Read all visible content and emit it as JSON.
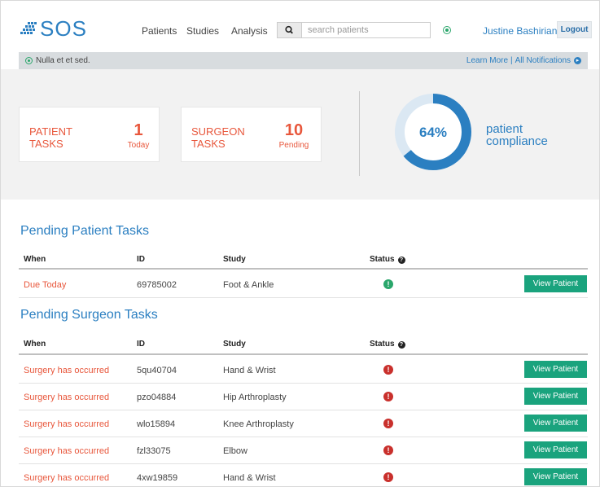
{
  "header": {
    "logo_text": "SOS",
    "nav": [
      "Patients",
      "Studies",
      "Analysis"
    ],
    "search": {
      "placeholder": "search patients",
      "value": ""
    },
    "user_name": "Justine Bashirian",
    "logout_label": "Logout"
  },
  "notice": {
    "message": "Nulla et et sed.",
    "learn_more": "Learn More",
    "separator": "|",
    "all_notifications": "All Notifications"
  },
  "stats": {
    "patient_tasks": {
      "label_line1": "PATIENT",
      "label_line2": "TASKS",
      "count": "1",
      "sub": "Today"
    },
    "surgeon_tasks": {
      "label_line1": "SURGEON",
      "label_line2": "TASKS",
      "count": "10",
      "sub": "Pending"
    },
    "compliance": {
      "percent_text": "64%",
      "value": 0.64,
      "label_line1": "patient",
      "label_line2": "compliance"
    }
  },
  "columns": {
    "when": "When",
    "id": "ID",
    "study": "Study",
    "status": "Status"
  },
  "pending_patient": {
    "title": "Pending Patient Tasks",
    "rows": [
      {
        "when": "Due Today",
        "id": "69785002",
        "study": "Foot & Ankle",
        "status": "ok",
        "button": "View Patient"
      }
    ]
  },
  "pending_surgeon": {
    "title": "Pending Surgeon Tasks",
    "rows": [
      {
        "when": "Surgery has occurred",
        "id": "5qu40704",
        "study": "Hand & Wrist",
        "status": "alert",
        "button": "View Patient"
      },
      {
        "when": "Surgery has occurred",
        "id": "pzo04884",
        "study": "Hip Arthroplasty",
        "status": "alert",
        "button": "View Patient"
      },
      {
        "when": "Surgery has occurred",
        "id": "wlo15894",
        "study": "Knee Arthroplasty",
        "status": "alert",
        "button": "View Patient"
      },
      {
        "when": "Surgery has occurred",
        "id": "fzl33075",
        "study": "Elbow",
        "status": "alert",
        "button": "View Patient"
      },
      {
        "when": "Surgery has occurred",
        "id": "4xw19859",
        "study": "Hand & Wrist",
        "status": "alert",
        "button": "View Patient"
      }
    ]
  },
  "colors": {
    "brand": "#2b7fc1",
    "alert": "#e8573c",
    "button": "#1aa37d",
    "ok": "#2aa66b",
    "error": "#c9302c",
    "gauge_track": "#dbe8f3"
  }
}
